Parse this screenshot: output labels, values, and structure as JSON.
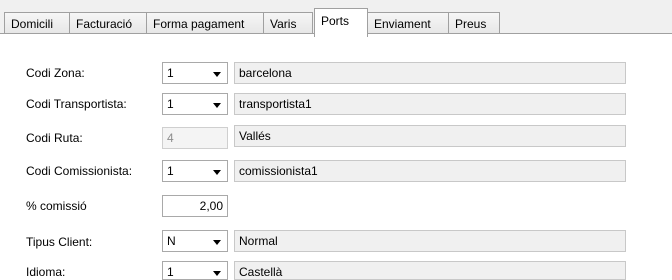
{
  "tabs": [
    {
      "label": "Domicili"
    },
    {
      "label": "Facturació"
    },
    {
      "label": "Forma pagament"
    },
    {
      "label": "Varis"
    },
    {
      "label": "Ports"
    },
    {
      "label": "Enviament"
    },
    {
      "label": "Preus"
    }
  ],
  "active_tab": "Ports",
  "form": {
    "codi_zona": {
      "label": "Codi Zona:",
      "value": "1",
      "description": "barcelona"
    },
    "codi_transportista": {
      "label": "Codi Transportista:",
      "value": "1",
      "description": "transportista1"
    },
    "codi_ruta": {
      "label": "Codi Ruta:",
      "value": "4",
      "description": "Vallés"
    },
    "codi_comissionista": {
      "label": "Codi Comissionista:",
      "value": "1",
      "description": "comissionista1"
    },
    "comissio": {
      "label": "% comissió",
      "value": "2,00"
    },
    "tipus_client": {
      "label": "Tipus Client:",
      "value": "N",
      "description": "Normal"
    },
    "idioma": {
      "label": "Idioma:",
      "value": "1",
      "description": "Castellà"
    }
  }
}
